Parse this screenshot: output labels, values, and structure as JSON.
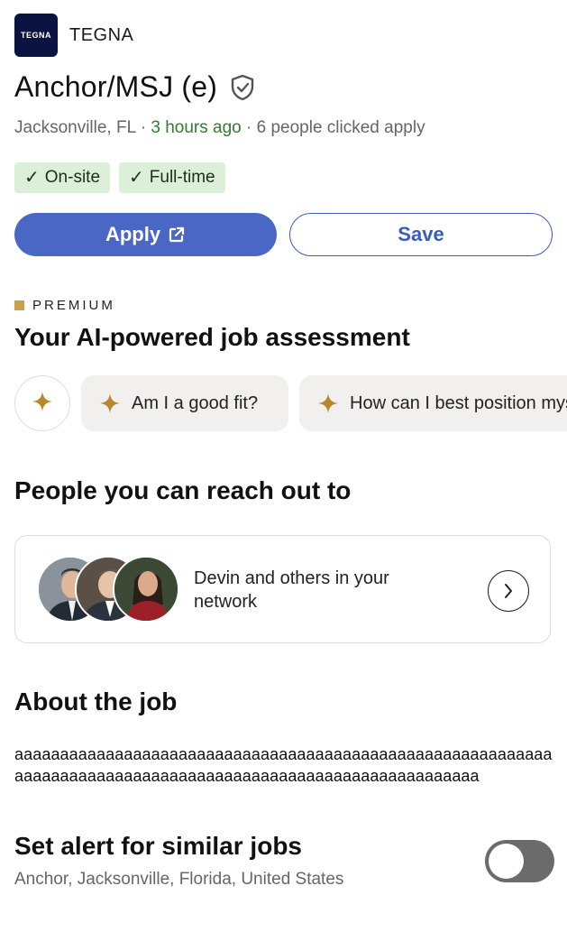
{
  "company": {
    "logo_text": "TEGNA",
    "name": "TEGNA"
  },
  "job": {
    "title": "Anchor/MSJ (e)",
    "location": "Jacksonville, FL",
    "separator": " · ",
    "posted": "3 hours ago",
    "applicants": "6 people clicked apply",
    "chips": [
      {
        "check": "✓",
        "label": "On-site"
      },
      {
        "check": "✓",
        "label": "Full-time"
      }
    ]
  },
  "actions": {
    "apply_label": "Apply",
    "save_label": "Save"
  },
  "premium": {
    "badge": "PREMIUM",
    "heading": "Your AI-powered job assessment",
    "prompts": [
      "Am I a good fit?",
      "How can I best position myself for this job?"
    ]
  },
  "people": {
    "heading": "People you can reach out to",
    "text": "Devin and others in your network"
  },
  "about": {
    "heading": "About the job",
    "body": "aaaaaaaaaaaaaaaaaaaaaaaaaaaaaaaaaaaaaaaaaaaaaaaaaaaaaaaaaaaaaaaaaaaaaaaaaaaaaaaaaaaaaaaaaaaaaaaaaaaaaaaaaaaaaa"
  },
  "alert": {
    "title": "Set alert for similar jobs",
    "subtitle": "Anchor, Jacksonville, Florida, United States",
    "enabled": false
  },
  "colors": {
    "accent": "#4a67c6",
    "premium_gold": "#c8a14a",
    "recent_green": "#2e7d32",
    "chip_bg": "#dcefd8"
  },
  "icons": {
    "verified": "shield-check-icon",
    "external": "external-link-icon",
    "ai": "sparkle-icon",
    "next": "chevron-right-icon"
  }
}
